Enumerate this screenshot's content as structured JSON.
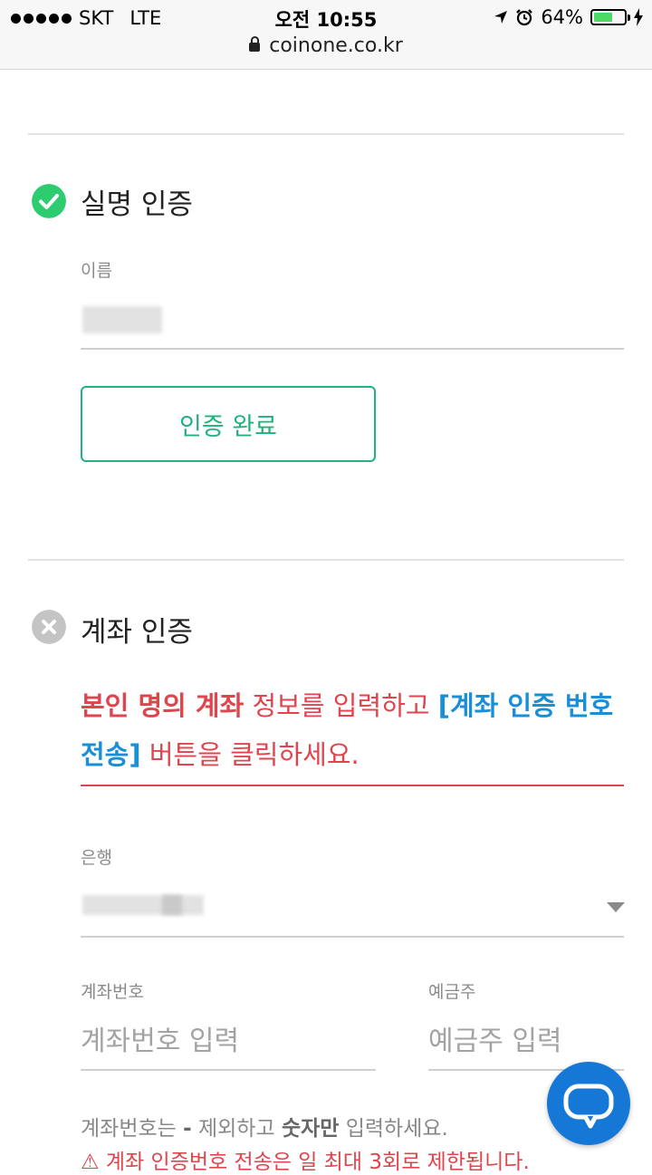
{
  "status_bar": {
    "carrier": "SKT",
    "network": "LTE",
    "time": "오전 10:55",
    "battery": "64%",
    "battery_level": 0.64,
    "url": "coinone.co.kr"
  },
  "name_section": {
    "title": "실명 인증",
    "name_label": "이름",
    "done_button": "인증 완료",
    "status_color": "#2ecc71"
  },
  "account_section": {
    "title": "계좌 인증",
    "status_color": "#bdbdbd",
    "notice": {
      "part1": "본인 명의 계좌",
      "part2": " 정보를 입력하고 ",
      "part3": "[계좌 인증 번호 전송]",
      "part4": " 버튼을 클릭하세요."
    },
    "bank_label": "은행",
    "account_number_label": "계좌번호",
    "account_number_placeholder": "계좌번호 입력",
    "holder_label": "예금주",
    "holder_placeholder": "예금주 입력",
    "hint": {
      "part1": "계좌번호는 ",
      "part2": "-",
      "part3": " 제외하고 ",
      "part4": "숫자만",
      "part5": " 입력하세요."
    },
    "warning": "⚠ 계좌 인증번호 전송은 일 최대 3회로 제한됩니다."
  },
  "colors": {
    "accent_green": "#22b07d",
    "alert_red": "#e0444c",
    "link_blue": "#1a8fd6",
    "chat_blue": "#1578d6"
  },
  "icons": {
    "name_status": "check-circle-icon",
    "account_status": "x-circle-icon",
    "chat": "chat-bubble-icon",
    "bank_dropdown": "caret-down-icon"
  }
}
